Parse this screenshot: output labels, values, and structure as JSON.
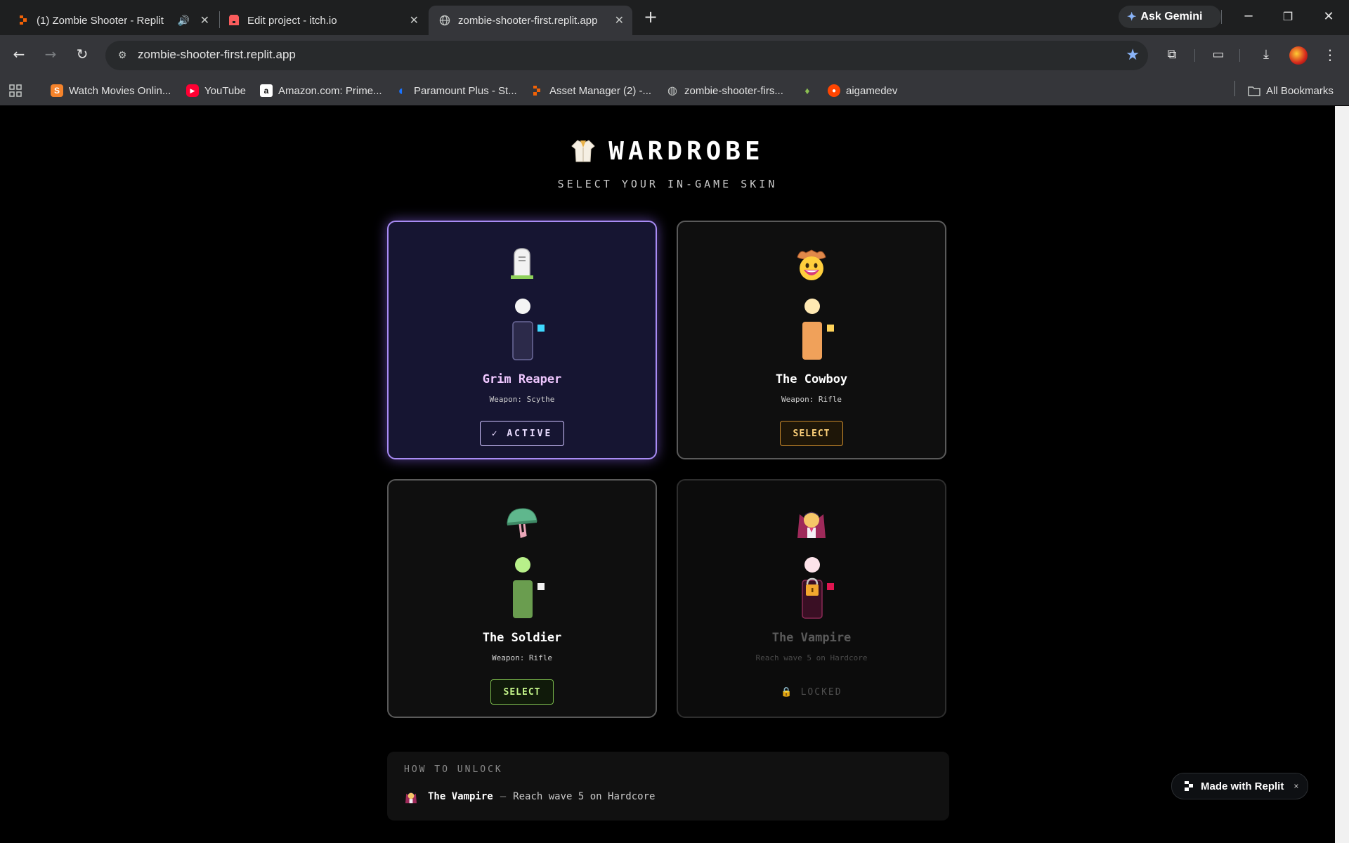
{
  "browser": {
    "tabs": [
      {
        "title": "(1) Zombie Shooter - Replit",
        "close": "✕"
      },
      {
        "title": "Edit project - itch.io",
        "close": "✕"
      },
      {
        "title": "zombie-shooter-first.replit.app",
        "close": "✕"
      }
    ],
    "new_tab": "+",
    "gemini_label": "Ask Gemini",
    "url": "zombie-shooter-first.replit.app",
    "bookmarks": [
      "Watch Movies Onlin...",
      "YouTube",
      "Amazon.com: Prime...",
      "Paramount Plus - St...",
      "Asset Manager (2) -...",
      "zombie-shooter-firs...",
      "aigamedev"
    ],
    "all_bookmarks": "All Bookmarks"
  },
  "page": {
    "title": "WARDROBE",
    "subtitle": "SELECT YOUR IN-GAME SKIN"
  },
  "skins": [
    {
      "name": "Grim Reaper",
      "weapon": "Weapon: Scythe",
      "button": "✓ ACTIVE",
      "state": "active",
      "head_color": "#f4f4f4",
      "body_color": "#2c2a4a",
      "accent_color": "#3fd9ff",
      "emoji": "headstone"
    },
    {
      "name": "The Cowboy",
      "weapon": "Weapon: Rifle",
      "button": "SELECT",
      "state": "available",
      "head_color": "#ffe9b3",
      "body_color": "#f0a15a",
      "accent_color": "#ffd35a",
      "emoji": "cowboy-face"
    },
    {
      "name": "The Soldier",
      "weapon": "Weapon: Rifle",
      "button": "SELECT",
      "state": "available",
      "head_color": "#b8f08a",
      "body_color": "#6a9d4f",
      "accent_color": "#f2f2f2",
      "emoji": "military-helmet"
    },
    {
      "name": "The Vampire",
      "weapon": "Reach wave 5 on Hardcore",
      "button": "LOCKED",
      "state": "locked",
      "head_color": "#fde3ea",
      "body_color": "#3a0f24",
      "accent_color": "#e01550",
      "emoji": "vampire"
    }
  ],
  "unlock": {
    "heading": "HOW TO UNLOCK",
    "skin_name": "The Vampire",
    "separator": "—",
    "requirement": "Reach wave 5 on Hardcore"
  },
  "badge": {
    "label": "Made with Replit",
    "close": "×"
  },
  "colors": {
    "active_border": "#a98cf5",
    "active_name": "#efc7ff",
    "cowboy_button": "#ffd27a",
    "soldier_button": "#c4f58a"
  }
}
